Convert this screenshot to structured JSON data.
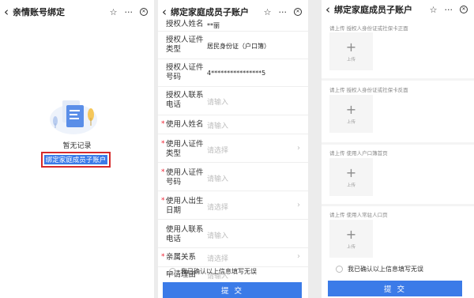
{
  "screen1": {
    "title": "亲情账号绑定",
    "back_icon": "‹",
    "star_icon": "☆",
    "more_icon": "···",
    "close_icon": "⊗",
    "empty_text": "暂无记录",
    "bind_button": "绑定家庭成员子账户"
  },
  "screen2": {
    "title": "绑定家庭成员子账户",
    "fields": [
      {
        "label": "授权人姓名",
        "value": "**丽",
        "placeholder": "",
        "required": false,
        "arrow": false
      },
      {
        "label": "授权人证件类型",
        "value": "居民身份证（户口簿）",
        "placeholder": "",
        "required": false,
        "arrow": false
      },
      {
        "label": "授权人证件号码",
        "value": "4****************5",
        "placeholder": "",
        "required": false,
        "arrow": false
      },
      {
        "label": "授权人联系电话",
        "value": "",
        "placeholder": "请输入",
        "required": false,
        "arrow": false
      },
      {
        "label": "使用人姓名",
        "value": "",
        "placeholder": "请输入",
        "required": true,
        "arrow": false
      },
      {
        "label": "使用人证件类型",
        "value": "",
        "placeholder": "请选择",
        "required": true,
        "arrow": true
      },
      {
        "label": "使用人证件号码",
        "value": "",
        "placeholder": "请输入",
        "required": true,
        "arrow": false
      },
      {
        "label": "使用人出生日期",
        "value": "",
        "placeholder": "请选择",
        "required": true,
        "arrow": true
      },
      {
        "label": "使用人联系电话",
        "value": "",
        "placeholder": "请输入",
        "required": false,
        "arrow": false
      },
      {
        "label": "亲属关系",
        "value": "",
        "placeholder": "请选择",
        "required": true,
        "arrow": true
      },
      {
        "label": "申请理由",
        "value": "",
        "placeholder": "请输入",
        "required": false,
        "arrow": false
      }
    ],
    "confirm_text": "我已确认以上信息填写无误",
    "submit_label": "提 交"
  },
  "screen3": {
    "title": "绑定家庭成员子账户",
    "uploads": [
      {
        "label": "请上传 授权人身份证或社保卡正面",
        "box_text": "上传"
      },
      {
        "label": "请上传 授权人身份证或社保卡反面",
        "box_text": "上传"
      },
      {
        "label": "请上传 使用人户口簿首页",
        "box_text": "上传"
      },
      {
        "label": "请上传 使用人常驻人口页",
        "box_text": "上传"
      }
    ],
    "confirm_text": "我已确认以上信息填写无误",
    "submit_label": "提 交"
  }
}
